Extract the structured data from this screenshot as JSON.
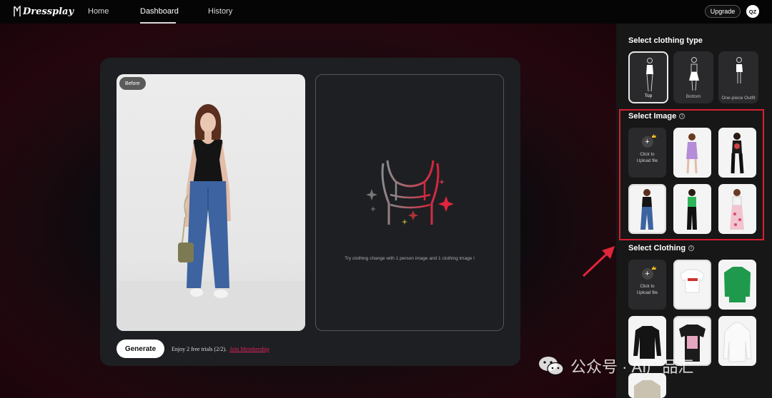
{
  "nav": {
    "logo": "Dressplay",
    "links": [
      "Home",
      "Dashboard",
      "History"
    ],
    "upgrade_label": "Upgrade",
    "avatar_initials": "QZ"
  },
  "workspace": {
    "before_badge": "Before",
    "result_hint": "Try clothing change with 1 person image and 1 clothing image !",
    "generate_label": "Generate",
    "trial_text": "Enjoy 2 free trials (2/2).",
    "join_label": "Join Membership"
  },
  "sidebar": {
    "clothing_type_title": "Select clothing type",
    "clothing_types": [
      "Top",
      "Bottom",
      "One-piece Outfit"
    ],
    "selected_type": "Top",
    "select_image_title": "Select Image",
    "select_clothing_title": "Select Clothing",
    "upload_label": "Click to Upload file"
  },
  "watermark": {
    "text": "公众号 · AI产品汇"
  },
  "colors": {
    "accent_red": "#d81f32",
    "link_pink": "#e0245e",
    "panel": "#1e1f22",
    "sidebar": "#171717"
  },
  "icons": [
    "info-icon",
    "plus-icon",
    "crown-icon",
    "sparkle-icon",
    "wechat-icon",
    "arrow-icon"
  ]
}
